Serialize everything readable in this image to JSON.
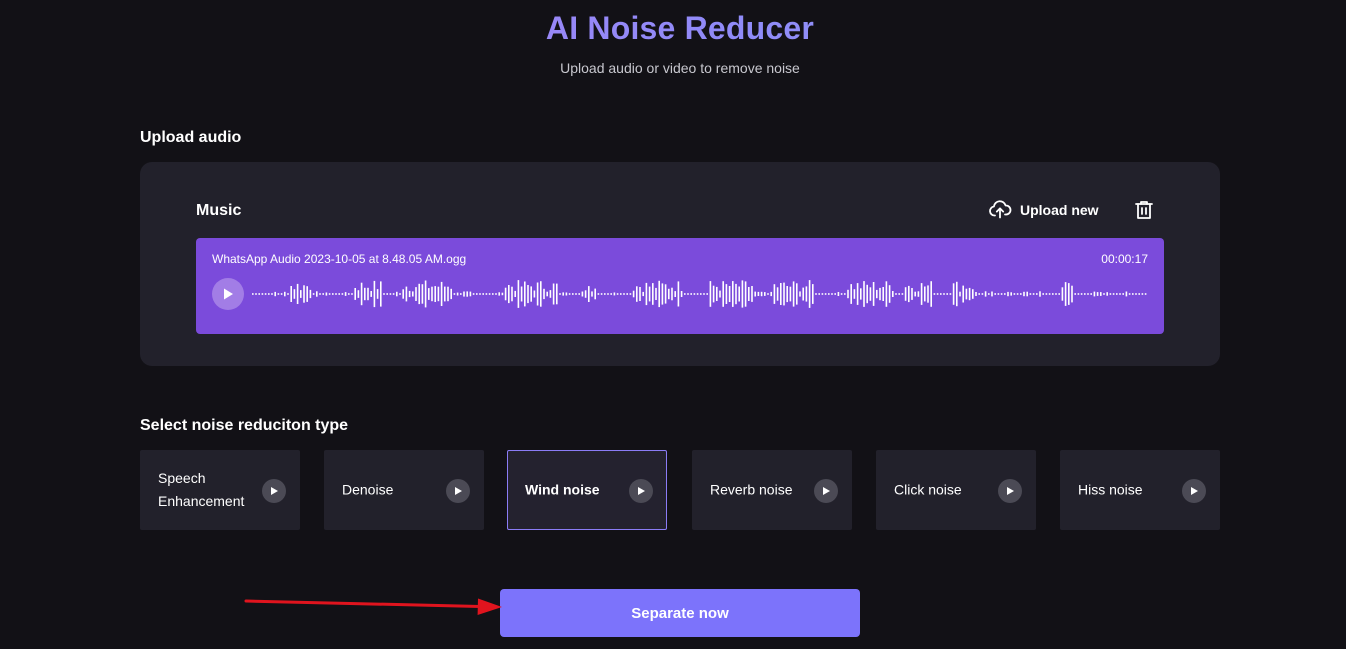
{
  "header": {
    "title": "AI Noise Reducer",
    "subtitle": "Upload audio or video to remove noise"
  },
  "upload_section": {
    "label": "Upload audio",
    "card_title": "Music",
    "upload_new_label": "Upload new",
    "player": {
      "file_name": "WhatsApp Audio 2023-10-05 at 8.48.05 AM.ogg",
      "duration": "00:00:17"
    }
  },
  "noise_section": {
    "label": "Select noise reduciton type",
    "options": [
      {
        "label": "Speech Enhancement",
        "selected": false
      },
      {
        "label": "Denoise",
        "selected": false
      },
      {
        "label": "Wind noise",
        "selected": true
      },
      {
        "label": "Reverb noise",
        "selected": false
      },
      {
        "label": "Click noise",
        "selected": false
      },
      {
        "label": "Hiss noise",
        "selected": false
      }
    ]
  },
  "action": {
    "separate_label": "Separate now"
  },
  "colors": {
    "background": "#121116",
    "card": "#22212b",
    "player": "#7b4bdb",
    "accent_button": "#7c73fb",
    "selected_border": "#8b7cf6",
    "annotation_arrow": "#e0141e"
  },
  "icons": {
    "upload": "cloud-upload-icon",
    "delete": "trash-icon",
    "play": "play-icon"
  }
}
